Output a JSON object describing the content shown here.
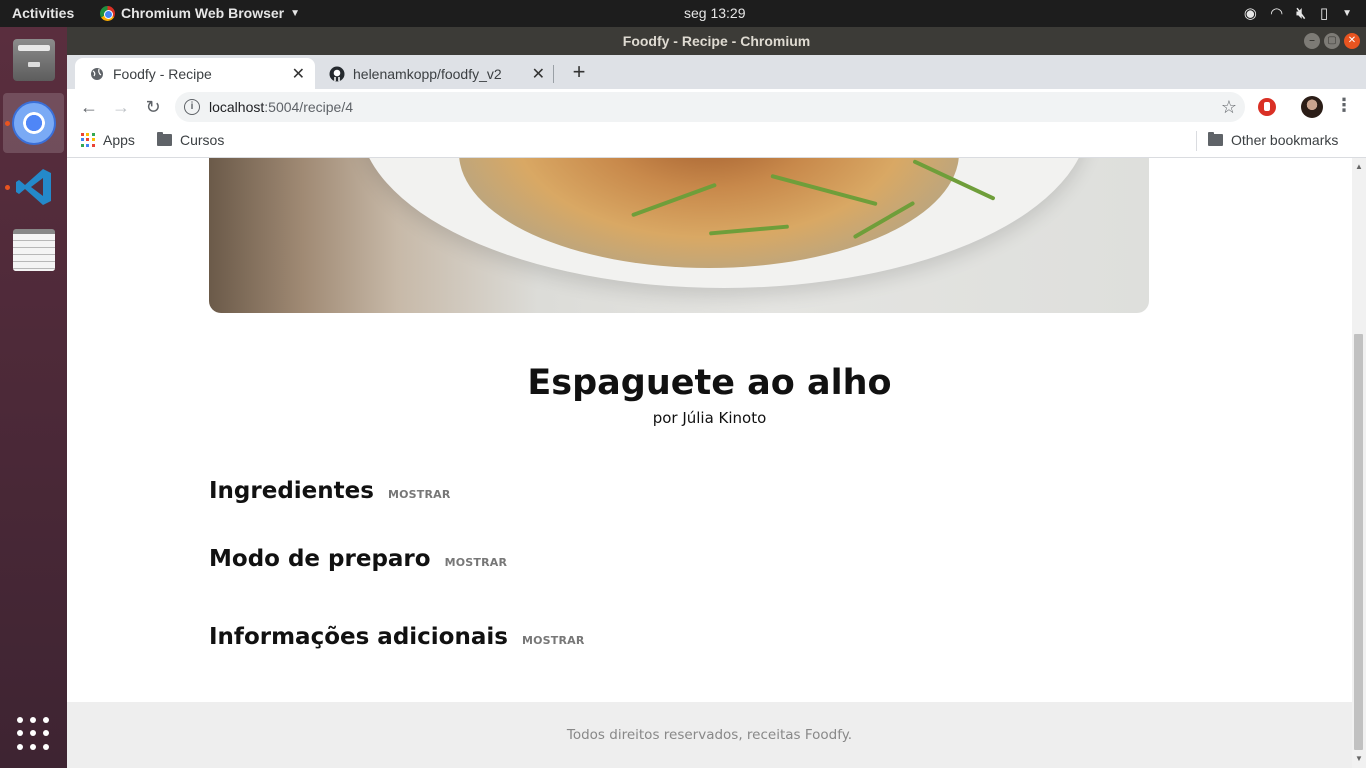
{
  "topbar": {
    "activities": "Activities",
    "app_name": "Chromium Web Browser",
    "clock": "seg 13:29"
  },
  "window": {
    "title": "Foodfy - Recipe - Chromium"
  },
  "tabs": [
    {
      "label": "Foodfy - Recipe",
      "active": true
    },
    {
      "label": "helenamkopp/foodfy_v2",
      "active": false
    }
  ],
  "address_bar": {
    "host": "localhost",
    "path": ":5004/recipe/4"
  },
  "bookmarks": {
    "apps": "Apps",
    "cursos": "Cursos",
    "other": "Other bookmarks"
  },
  "recipe": {
    "title": "Espaguete ao alho",
    "author": "por Júlia Kinoto",
    "sections": [
      {
        "title": "Ingredientes",
        "toggle": "MOSTRAR"
      },
      {
        "title": "Modo de preparo",
        "toggle": "MOSTRAR"
      },
      {
        "title": "Informações adicionais",
        "toggle": "MOSTRAR"
      }
    ]
  },
  "footer": {
    "text": "Todos direitos reservados, receitas Foodfy."
  },
  "colors": {
    "ubuntu_orange": "#e95420",
    "footer_bg": "#eeeeee",
    "toggle_gray": "#777777"
  }
}
